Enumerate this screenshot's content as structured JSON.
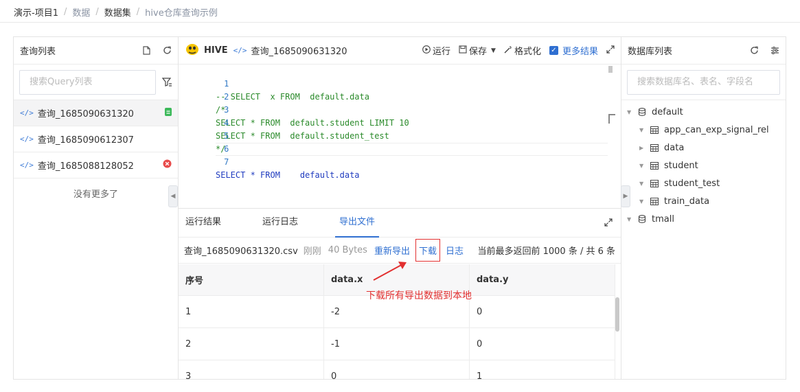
{
  "breadcrumb": [
    "演示-项目1",
    "数据",
    "数据集",
    "hive仓库查询示例"
  ],
  "query_panel": {
    "title": "查询列表",
    "search_placeholder": "搜索Query列表",
    "items": [
      {
        "name": "查询_1685090631320",
        "status": "success"
      },
      {
        "name": "查询_1685090612307",
        "status": "none"
      },
      {
        "name": "查询_1685088128052",
        "status": "error"
      }
    ],
    "no_more": "没有更多了"
  },
  "editor": {
    "engine": "HIVE",
    "query_name": "查询_1685090631320",
    "run_label": "运行",
    "save_label": "保存",
    "format_label": "格式化",
    "more_results_label": "更多结果",
    "more_results_checked": true,
    "lines": [
      {
        "n": "1",
        "text": "-- SELECT  x FROM  default.data"
      },
      {
        "n": "2",
        "text": "/*"
      },
      {
        "n": "3",
        "text": "SELECT * FROM  default.student LIMIT 10"
      },
      {
        "n": "4",
        "text": "SELECT * FROM  default.student_test"
      },
      {
        "n": "5",
        "text": "*/"
      },
      {
        "n": "6",
        "text": ""
      },
      {
        "n": "7",
        "text": "SELECT * FROM    default.data"
      }
    ]
  },
  "results": {
    "tabs": [
      "运行结果",
      "运行日志",
      "导出文件"
    ],
    "active_tab": 2,
    "file_name": "查询_1685090631320.csv",
    "file_time": "刚刚",
    "file_size": "40 Bytes",
    "reexport_label": "重新导出",
    "download_label": "下载",
    "log_label": "日志",
    "summary": "当前最多返回前 1000 条 / 共 6 条",
    "columns": [
      "序号",
      "data.x",
      "data.y"
    ],
    "rows": [
      [
        "1",
        "-2",
        "0"
      ],
      [
        "2",
        "-1",
        "0"
      ],
      [
        "3",
        "0",
        "1"
      ]
    ]
  },
  "annotation": "下载所有导出数据到本地",
  "db_panel": {
    "title": "数据库列表",
    "search_placeholder": "搜索数据库名、表名、字段名",
    "tree": [
      {
        "label": "default",
        "type": "db",
        "level": 0,
        "expanded": true
      },
      {
        "label": "app_can_exp_signal_rel",
        "type": "table",
        "level": 1
      },
      {
        "label": "data",
        "type": "table",
        "level": 1
      },
      {
        "label": "student",
        "type": "table",
        "level": 1
      },
      {
        "label": "student_test",
        "type": "table",
        "level": 1
      },
      {
        "label": "train_data",
        "type": "table",
        "level": 1
      },
      {
        "label": "tmall",
        "type": "db",
        "level": 0,
        "expanded": true
      }
    ]
  },
  "colors": {
    "accent": "#2f6fd1",
    "annotation": "#e23030",
    "success": "#3cb95a",
    "error": "#e84b4b"
  }
}
